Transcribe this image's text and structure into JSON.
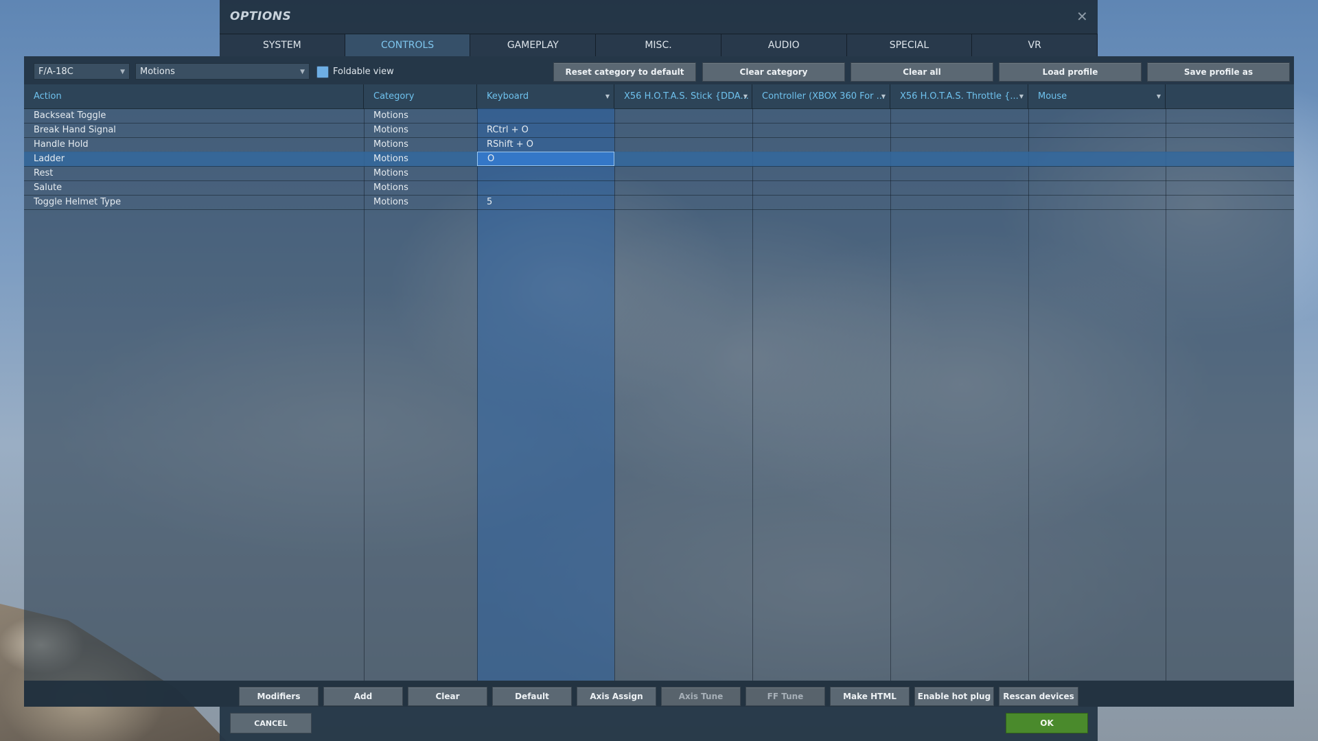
{
  "window": {
    "title": "OPTIONS",
    "close_icon": "close-icon"
  },
  "tabs": [
    {
      "label": "SYSTEM"
    },
    {
      "label": "CONTROLS"
    },
    {
      "label": "GAMEPLAY"
    },
    {
      "label": "MISC."
    },
    {
      "label": "AUDIO"
    },
    {
      "label": "SPECIAL"
    },
    {
      "label": "VR"
    }
  ],
  "active_tab": "CONTROLS",
  "toolbar": {
    "aircraft_select": "F/A-18C",
    "category_select": "Motions",
    "foldable_view_label": "Foldable view",
    "foldable_view_checked": true,
    "buttons": [
      "Reset category to default",
      "Clear category",
      "Clear all",
      "Load profile",
      "Save profile as"
    ]
  },
  "columns": {
    "action": "Action",
    "category": "Category",
    "devices": [
      "Keyboard",
      "X56 H.O.T.A.S. Stick {DDA...",
      "Controller (XBOX 360 For ...",
      "X56 H.O.T.A.S. Throttle {...",
      "Mouse"
    ]
  },
  "rows": [
    {
      "action": "Backseat Toggle",
      "category": "Motions",
      "keyboard": ""
    },
    {
      "action": "Break Hand Signal",
      "category": "Motions",
      "keyboard": "RCtrl + O"
    },
    {
      "action": "Handle Hold",
      "category": "Motions",
      "keyboard": "RShift + O"
    },
    {
      "action": "Ladder",
      "category": "Motions",
      "keyboard": "O"
    },
    {
      "action": "Rest",
      "category": "Motions",
      "keyboard": ""
    },
    {
      "action": "Salute",
      "category": "Motions",
      "keyboard": ""
    },
    {
      "action": "Toggle Helmet Type",
      "category": "Motions",
      "keyboard": "5"
    }
  ],
  "selected_row": "Ladder",
  "bottom_buttons": [
    {
      "label": "Modifiers",
      "enabled": true
    },
    {
      "label": "Add",
      "enabled": true
    },
    {
      "label": "Clear",
      "enabled": true
    },
    {
      "label": "Default",
      "enabled": true
    },
    {
      "label": "Axis Assign",
      "enabled": true
    },
    {
      "label": "Axis Tune",
      "enabled": false
    },
    {
      "label": "FF Tune",
      "enabled": false
    },
    {
      "label": "Make HTML",
      "enabled": true
    },
    {
      "label": "Enable hot plug",
      "enabled": true
    },
    {
      "label": "Rescan devices",
      "enabled": true
    }
  ],
  "footer": {
    "cancel_label": "CANCEL",
    "ok_label": "OK"
  },
  "colors": {
    "accent": "#6fc2ee",
    "ok_green": "#4a8a2c",
    "selection_blue": "#3477c7"
  }
}
